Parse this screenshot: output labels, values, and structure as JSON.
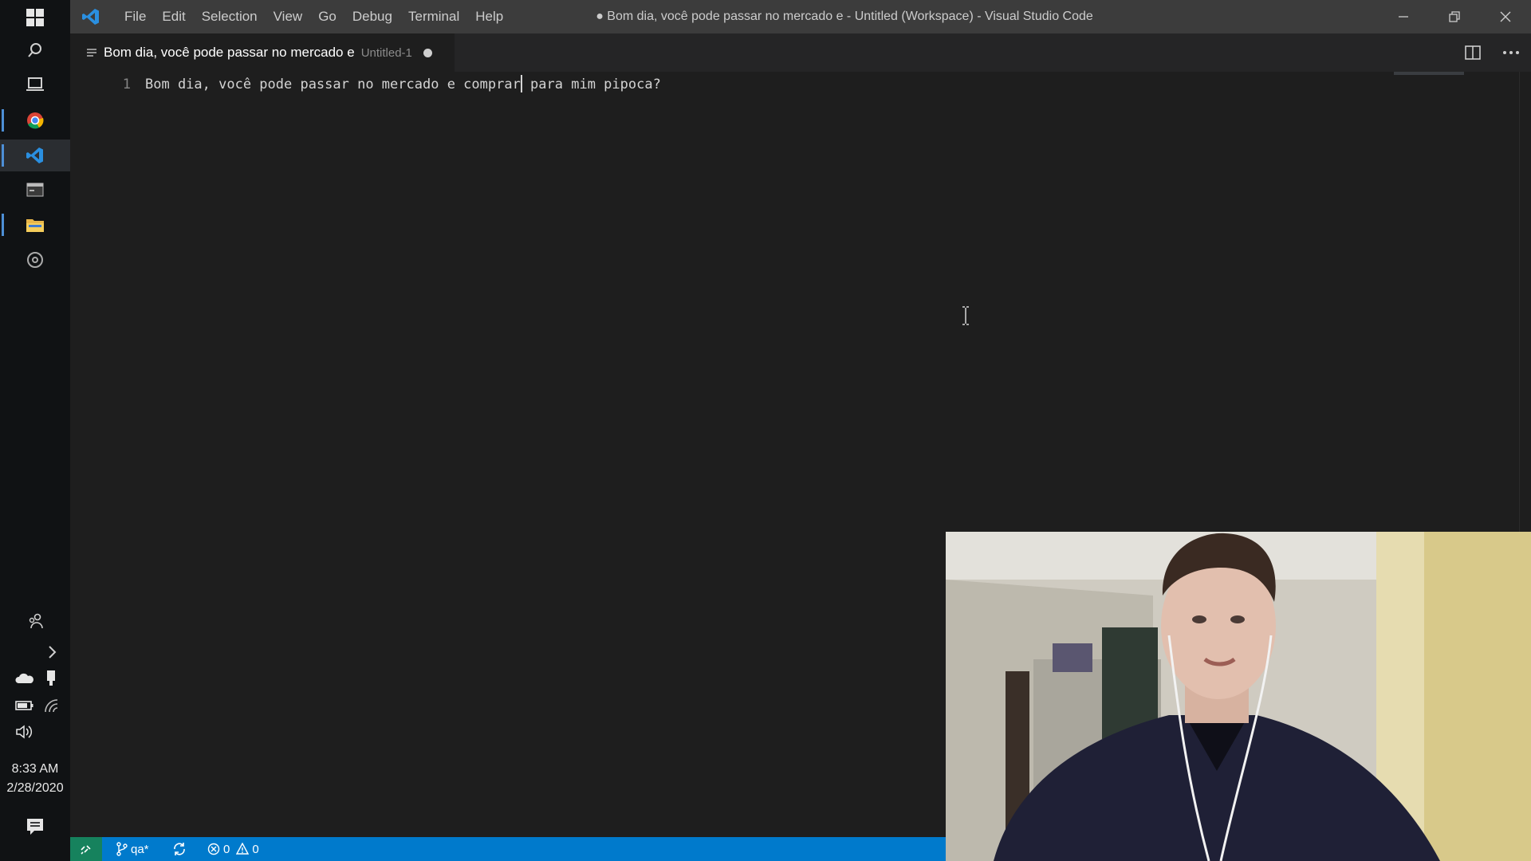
{
  "window": {
    "title": "● Bom dia, você pode passar no mercado e - Untitled (Workspace) - Visual Studio Code"
  },
  "menu": {
    "items": [
      "File",
      "Edit",
      "Selection",
      "View",
      "Go",
      "Debug",
      "Terminal",
      "Help"
    ]
  },
  "tab": {
    "name": "Bom dia, você pode passar no mercado e",
    "description": "Untitled-1"
  },
  "editor": {
    "line_number": "1",
    "text_before_cursor": "Bom dia, você pode passar no mercado e comprar",
    "text_after_cursor": " para mim pipoca?"
  },
  "statusbar": {
    "branch": "qa*",
    "errors": "0",
    "warnings": "0"
  },
  "taskbar": {
    "time": "8:33 AM",
    "date": "2/28/2020",
    "items": [
      "windows-start",
      "search",
      "task-view",
      "chrome",
      "vscode",
      "terminal",
      "file-explorer",
      "settings"
    ]
  },
  "colors": {
    "titlebar": "#3c3c3c",
    "editor_bg": "#1e1e1e",
    "statusbar": "#007acc",
    "remote": "#16825d"
  }
}
